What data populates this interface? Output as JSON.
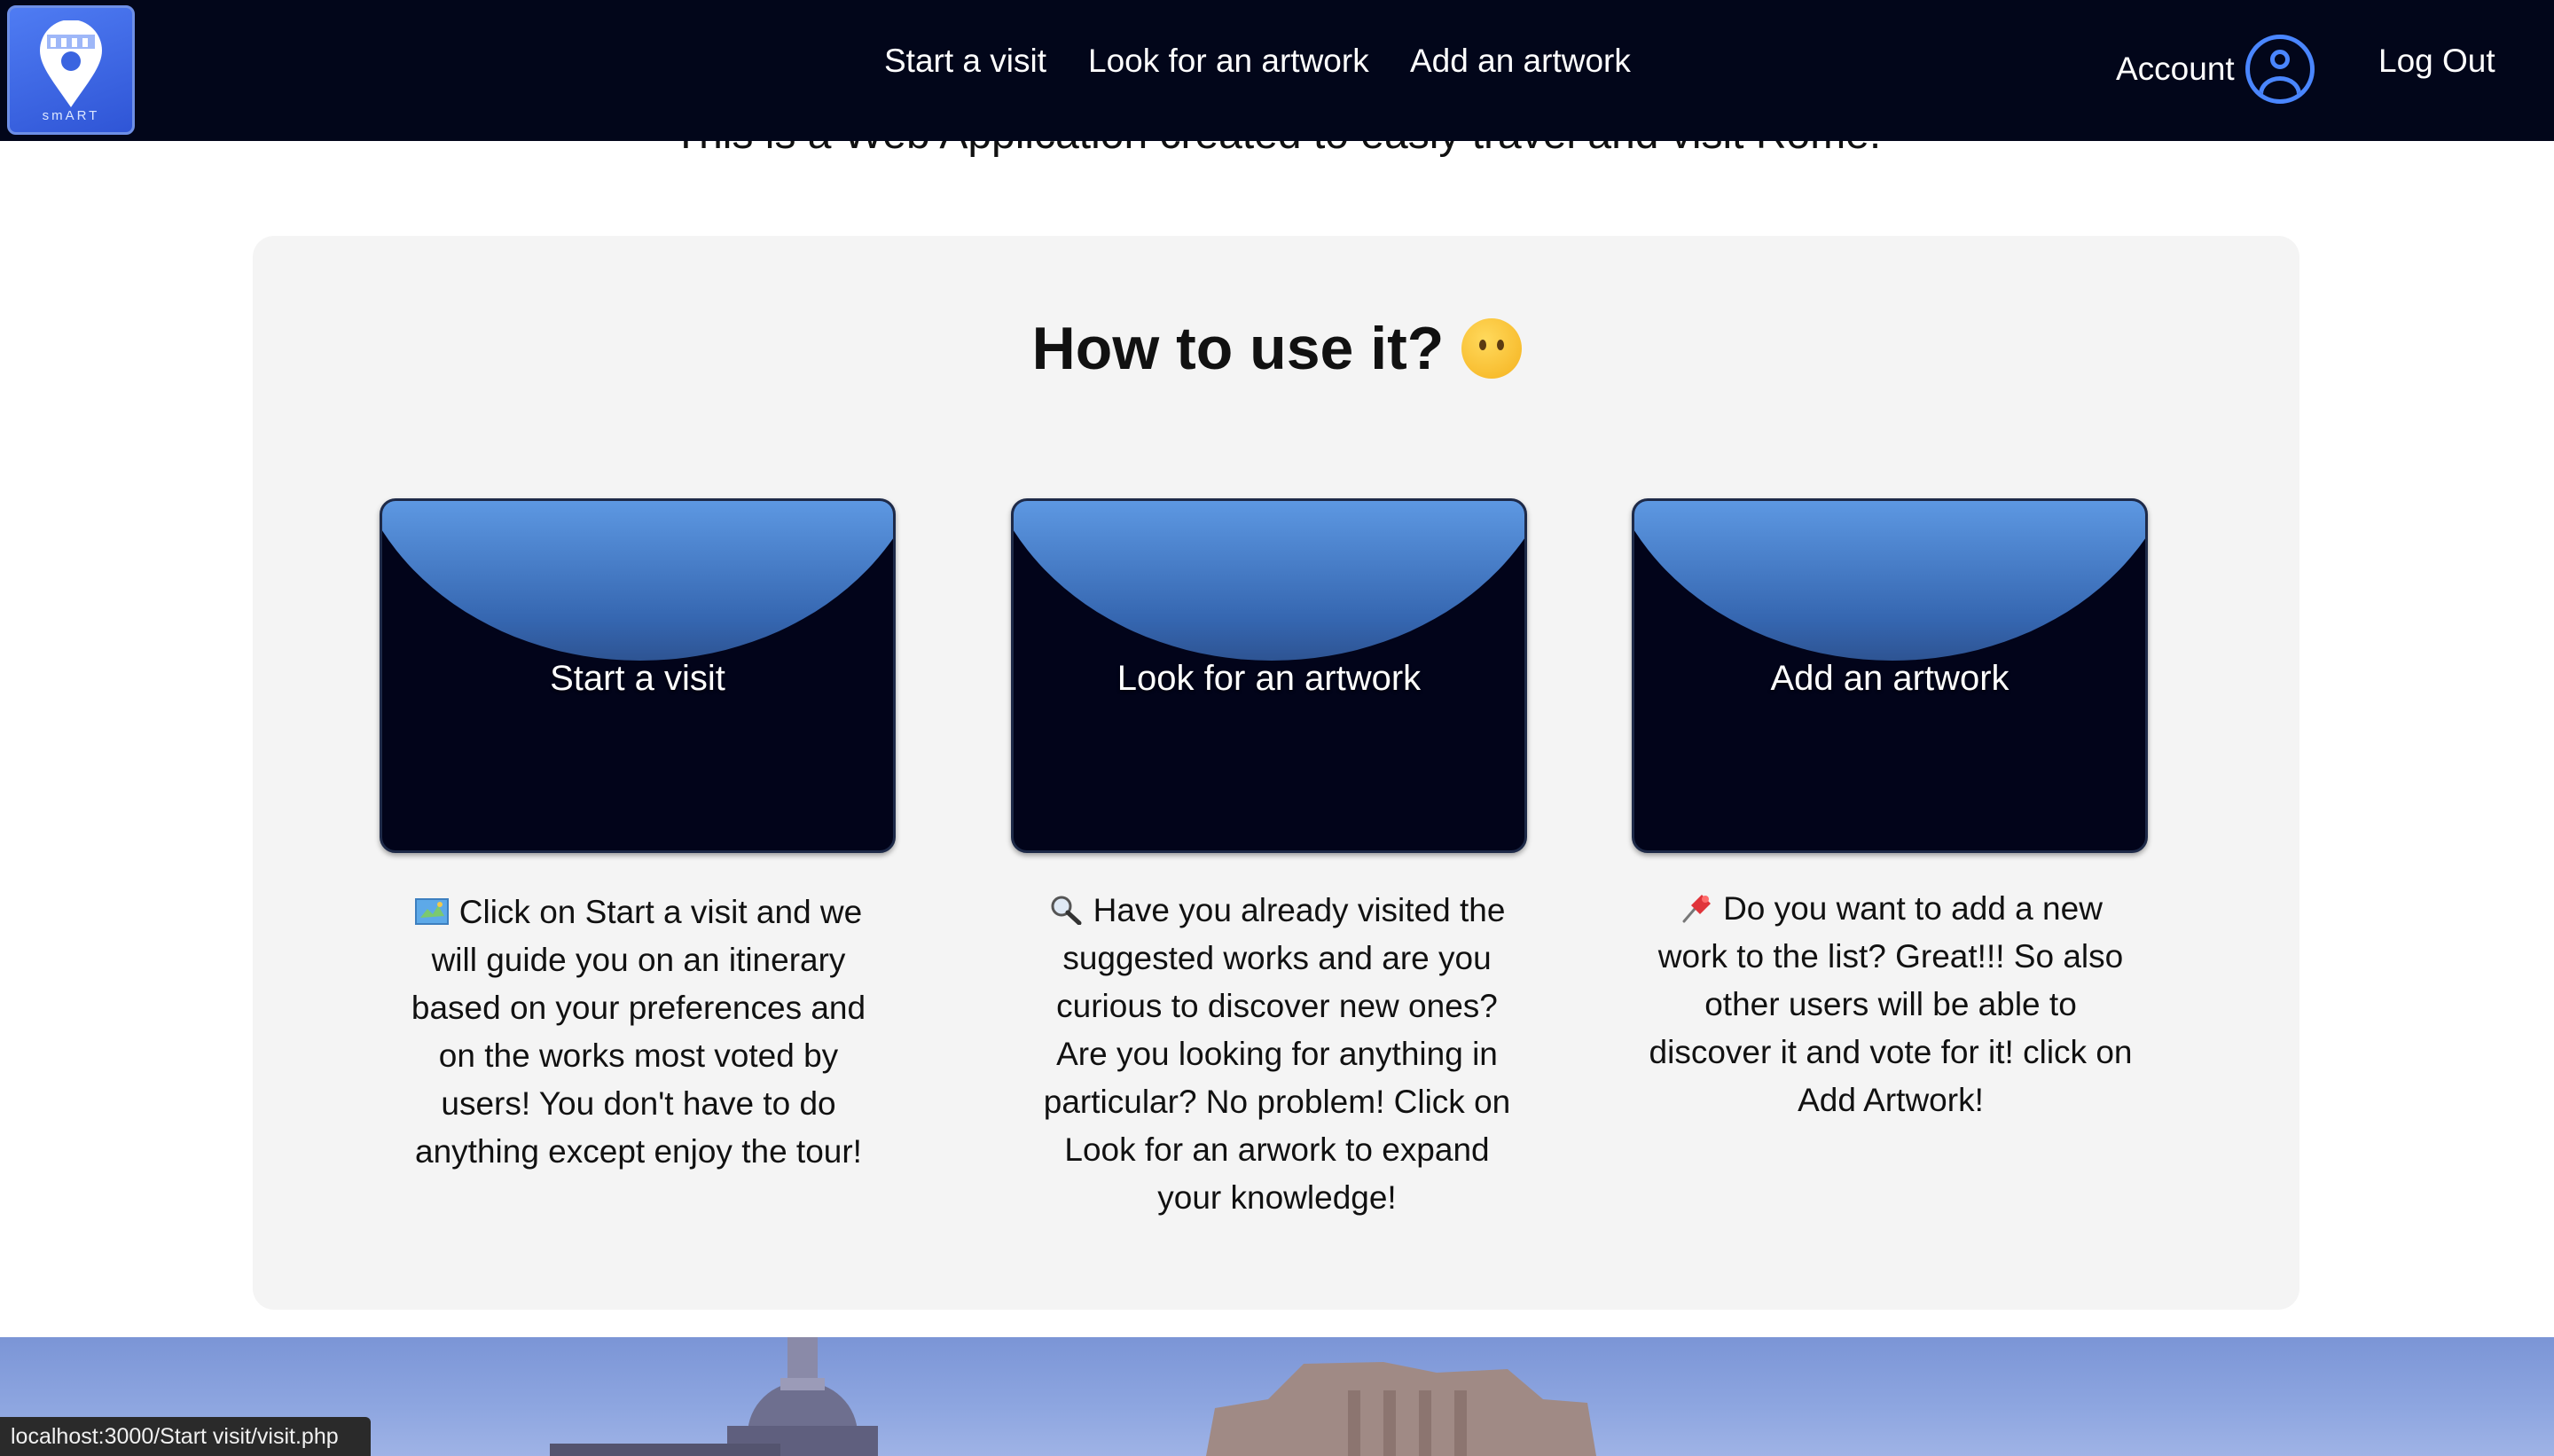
{
  "header": {
    "logo_text": "smART",
    "nav": [
      {
        "label": "Start a visit"
      },
      {
        "label": "Look for an artwork"
      },
      {
        "label": "Add an artwork"
      }
    ],
    "account_label": "Account",
    "logout_label": "Log Out"
  },
  "intro_text": "This is a Web Application created to easly travel and visit Rome.",
  "how_to": {
    "title": "How to use it?",
    "cards": [
      {
        "button_label": "Start a visit",
        "description": "Click on Start a visit and we will guide you on an itinerary based on your preferences and on the works most voted by users! You don't have to do anything except enjoy the tour!",
        "icon": "map-icon"
      },
      {
        "button_label": "Look for an artwork",
        "description": "Have you already visited the suggested works and are you curious to discover new ones? Are you looking for anything in particular? No problem! Click on Look for an arwork to expand your knowledge!",
        "icon": "magnifier-icon"
      },
      {
        "button_label": "Add an artwork",
        "description": "Do you want to add a new work to the list? Great!!! So also other users will be able to discover it and vote for it! click on Add Artwork!",
        "icon": "pushpin-icon"
      }
    ]
  },
  "status_url": "localhost:3000/Start visit/visit.php",
  "colors": {
    "navbar": "#02061a",
    "accent": "#4a86ff",
    "card_dark": "#02041a",
    "card_glow": "#6aa8f2",
    "panel_bg": "#f4f4f4"
  }
}
